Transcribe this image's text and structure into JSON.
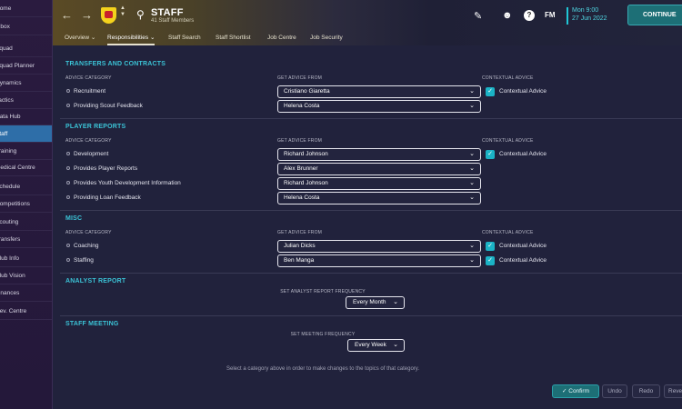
{
  "sidebar": {
    "items": [
      {
        "label": "Home",
        "active": false
      },
      {
        "label": "Inbox",
        "active": false
      },
      {
        "label": "Squad",
        "active": false
      },
      {
        "label": "Squad Planner",
        "active": false
      },
      {
        "label": "Dynamics",
        "active": false
      },
      {
        "label": "Tactics",
        "active": false
      },
      {
        "label": "Data Hub",
        "active": false
      },
      {
        "label": "Staff",
        "active": true
      },
      {
        "label": "Training",
        "active": false
      },
      {
        "label": "Medical Centre",
        "active": false
      },
      {
        "label": "Schedule",
        "active": false
      },
      {
        "label": "Competitions",
        "active": false
      },
      {
        "label": "Scouting",
        "active": false
      },
      {
        "label": "Transfers",
        "active": false
      },
      {
        "label": "Club Info",
        "active": false
      },
      {
        "label": "Club Vision",
        "active": false
      },
      {
        "label": "Finances",
        "active": false
      },
      {
        "label": "Dev. Centre",
        "active": false
      }
    ]
  },
  "header": {
    "back_glyph": "←",
    "forward_glyph": "→",
    "title": "STAFF",
    "subtitle": "41 Staff Members",
    "time": "Mon 9:00",
    "date": "27 Jun 2022",
    "continue_label": "CONTINUE",
    "help_glyph": "?",
    "fm_label": "FM",
    "accent": "#1fc7d6"
  },
  "tabs": [
    {
      "label": "Overview ⌄",
      "active": false
    },
    {
      "label": "Responsibilities ⌄",
      "active": true
    },
    {
      "label": "Staff Search",
      "active": false
    },
    {
      "label": "Staff Shortlist",
      "active": false
    },
    {
      "label": "Job Centre",
      "active": false
    },
    {
      "label": "Job Security",
      "active": false
    }
  ],
  "col_heads": {
    "category": "ADVICE CATEGORY",
    "from": "GET ADVICE FROM",
    "contextual": "CONTEXTUAL ADVICE"
  },
  "transfers": {
    "title": "TRANSFERS AND CONTRACTS",
    "rows": [
      {
        "label": "Recruitment",
        "advisor": "Cristiano Giaretta",
        "contextual": true,
        "contextual_label": "Contextual Advice"
      },
      {
        "label": "Providing Scout Feedback",
        "advisor": "Helena Costa",
        "contextual": false
      }
    ]
  },
  "player_reports": {
    "title": "PLAYER REPORTS",
    "rows": [
      {
        "label": "Development",
        "advisor": "Richard Johnson",
        "contextual": true,
        "contextual_label": "Contextual Advice"
      },
      {
        "label": "Provides Player Reports",
        "advisor": "Alex Brunner",
        "contextual": false
      },
      {
        "label": "Provides Youth Development Information",
        "advisor": "Richard Johnson",
        "contextual": false
      },
      {
        "label": "Providing Loan Feedback",
        "advisor": "Helena Costa",
        "contextual": false
      }
    ]
  },
  "misc": {
    "title": "MISC",
    "rows": [
      {
        "label": "Coaching",
        "advisor": "Julian Dicks",
        "contextual": true,
        "contextual_label": "Contextual Advice"
      },
      {
        "label": "Staffing",
        "advisor": "Ben Manga",
        "contextual": true,
        "contextual_label": "Contextual Advice"
      }
    ]
  },
  "analyst": {
    "title": "ANALYST REPORT",
    "freq_label": "SET ANALYST REPORT FREQUENCY",
    "freq_value": "Every Month"
  },
  "meeting": {
    "title": "STAFF MEETING",
    "freq_label": "SET MEETING FREQUENCY",
    "freq_value": "Every Week"
  },
  "footer": {
    "hint": "Select a category above in order to make changes to the topics of that category.",
    "confirm": "Confirm",
    "undo": "Undo",
    "redo": "Redo",
    "revert": "Revert"
  }
}
